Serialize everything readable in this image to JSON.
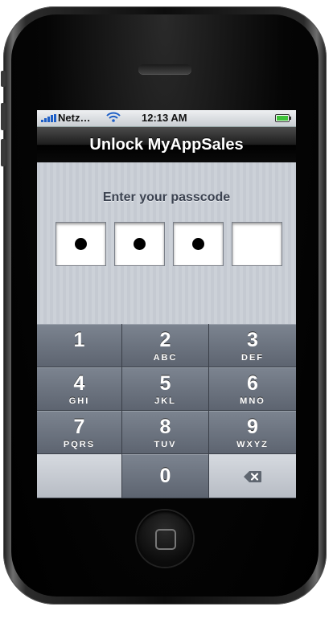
{
  "status_bar": {
    "carrier": "Netz…",
    "time": "12:13 AM",
    "signal_icon": "signal-bars-icon",
    "wifi_icon": "wifi-icon",
    "battery_icon": "battery-icon"
  },
  "nav": {
    "title": "Unlock MyAppSales"
  },
  "passcode": {
    "prompt": "Enter your passcode",
    "digits_entered": 3,
    "digits_total": 4
  },
  "keypad": {
    "keys": [
      {
        "number": "1",
        "letters": ""
      },
      {
        "number": "2",
        "letters": "ABC"
      },
      {
        "number": "3",
        "letters": "DEF"
      },
      {
        "number": "4",
        "letters": "GHI"
      },
      {
        "number": "5",
        "letters": "JKL"
      },
      {
        "number": "6",
        "letters": "MNO"
      },
      {
        "number": "7",
        "letters": "PQRS"
      },
      {
        "number": "8",
        "letters": "TUV"
      },
      {
        "number": "9",
        "letters": "WXYZ"
      },
      {
        "number": "0",
        "letters": ""
      }
    ],
    "delete_icon": "backspace-icon"
  },
  "colors": {
    "nav_bg": "#000000",
    "keypad_key": "#6a717d",
    "keypad_light": "#c7ccd3",
    "battery_fill": "#3fc23a",
    "signal": "#1e5fc6"
  }
}
